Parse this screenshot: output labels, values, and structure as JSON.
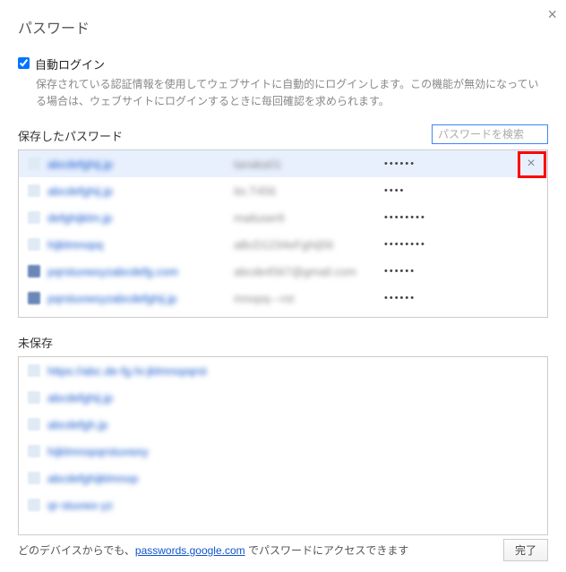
{
  "dialog": {
    "title": "パスワード",
    "close_label": "×"
  },
  "autologin": {
    "checked": true,
    "label": "自動ログイン",
    "description": "保存されている認証情報を使用してウェブサイトに自動的にログインします。この機能が無効になっている場合は、ウェブサイトにログインするときに毎回確認を求められます。"
  },
  "saved": {
    "title": "保存したパスワード",
    "search_placeholder": "パスワードを検索",
    "rows": [
      {
        "site": "abcdefghij.jp",
        "user": "tanaka01",
        "pass": "••••••",
        "selected": true,
        "icon": "light"
      },
      {
        "site": "abcdefghij.jp",
        "user": "ito.T456",
        "pass": "••••",
        "icon": "light"
      },
      {
        "site": "defghijklm.jp",
        "user": "mailuser9",
        "pass": "••••••••",
        "icon": "light"
      },
      {
        "site": "hijklmnopq",
        "user": "aBcD1234eFghIj56",
        "pass": "••••••••",
        "icon": "light"
      },
      {
        "site": "pqrstuvwxyzabcdefg.com",
        "user": "abcde4567@gmail.com",
        "pass": "••••••",
        "icon": "dark"
      },
      {
        "site": "pqrstuvwxyzabcdefghij.jp",
        "user": "mnopq---rst",
        "pass": "••••••",
        "icon": "dark"
      }
    ],
    "delete_label": "×"
  },
  "unsaved": {
    "title": "未保存",
    "rows": [
      {
        "site": "https://abc.de-fg.hi-jklmnopqrst"
      },
      {
        "site": "abcdefghij.jp"
      },
      {
        "site": "abcdefgh.jp"
      },
      {
        "site": "hijklmnopqrstuvwxy"
      },
      {
        "site": "abcdefghijklmnop"
      },
      {
        "site": "qr-stuvwx-yz"
      }
    ]
  },
  "footer": {
    "text_before": "どのデバイスからでも、",
    "link_text": "passwords.google.com",
    "text_after": " でパスワードにアクセスできます",
    "done": "完了"
  }
}
